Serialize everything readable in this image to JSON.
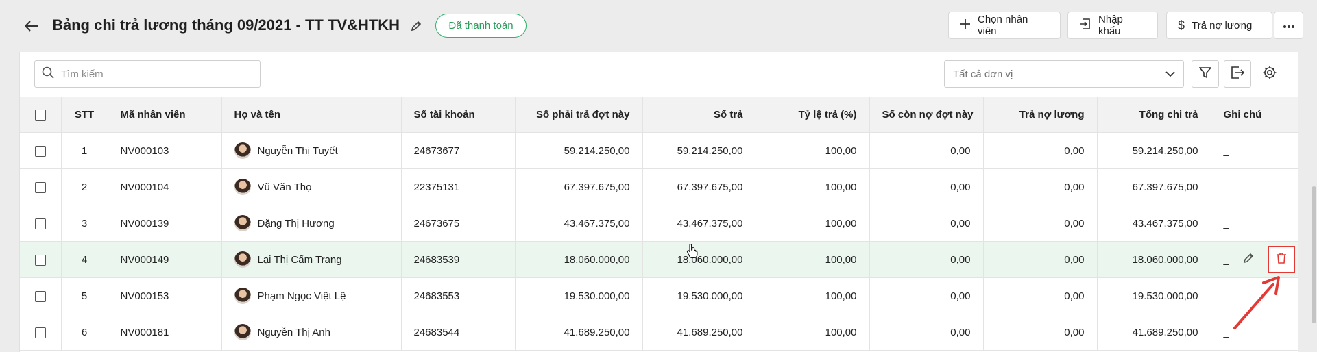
{
  "header": {
    "title": "Bảng chi trả lương tháng 09/2021 - TT TV&HTKH",
    "status": "Đã thanh toán",
    "buttons": {
      "choose": "Chọn nhân viên",
      "import": "Nhập khẩu",
      "pay_debt": "Trả nợ lương"
    }
  },
  "toolbar": {
    "search_placeholder": "Tìm kiếm",
    "unit_select": "Tất cả đơn vị"
  },
  "table": {
    "columns": [
      "STT",
      "Mã nhân viên",
      "Họ và tên",
      "Số tài khoản",
      "Số phải trả đợt này",
      "Số trả",
      "Tỷ lệ trả (%)",
      "Số còn nợ đợt này",
      "Trả nợ lương",
      "Tổng chi trả",
      "Ghi chú"
    ],
    "rows": [
      {
        "stt": "1",
        "code": "NV000103",
        "name": "Nguyễn Thị Tuyết",
        "account": "24673677",
        "due": "59.214.250,00",
        "paid": "59.214.250,00",
        "rate": "100,00",
        "remaining": "0,00",
        "debt_pay": "0,00",
        "total": "59.214.250,00",
        "note": "_"
      },
      {
        "stt": "2",
        "code": "NV000104",
        "name": "Vũ Văn Thọ",
        "account": "22375131",
        "due": "67.397.675,00",
        "paid": "67.397.675,00",
        "rate": "100,00",
        "remaining": "0,00",
        "debt_pay": "0,00",
        "total": "67.397.675,00",
        "note": "_"
      },
      {
        "stt": "3",
        "code": "NV000139",
        "name": "Đặng Thị Hương",
        "account": "24673675",
        "due": "43.467.375,00",
        "paid": "43.467.375,00",
        "rate": "100,00",
        "remaining": "0,00",
        "debt_pay": "0,00",
        "total": "43.467.375,00",
        "note": "_"
      },
      {
        "stt": "4",
        "code": "NV000149",
        "name": "Lại Thị Cẩm Trang",
        "account": "24683539",
        "due": "18.060.000,00",
        "paid": "18.060.000,00",
        "rate": "100,00",
        "remaining": "0,00",
        "debt_pay": "0,00",
        "total": "18.060.000,00",
        "note": "_"
      },
      {
        "stt": "5",
        "code": "NV000153",
        "name": "Phạm Ngọc Việt Lệ",
        "account": "24683553",
        "due": "19.530.000,00",
        "paid": "19.530.000,00",
        "rate": "100,00",
        "remaining": "0,00",
        "debt_pay": "0,00",
        "total": "19.530.000,00",
        "note": "_"
      },
      {
        "stt": "6",
        "code": "NV000181",
        "name": "Nguyễn Thị Anh",
        "account": "24683544",
        "due": "41.689.250,00",
        "paid": "41.689.250,00",
        "rate": "100,00",
        "remaining": "0,00",
        "debt_pay": "0,00",
        "total": "41.689.250,00",
        "note": "_"
      }
    ]
  },
  "colors": {
    "status_green": "#2fb26b",
    "highlight_row": "#eaf6ee",
    "annotation_red": "#e53935"
  }
}
